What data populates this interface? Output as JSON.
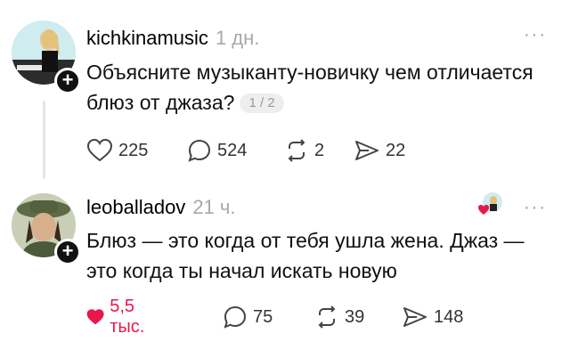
{
  "posts": [
    {
      "username": "kichkinamusic",
      "time": "1 дн.",
      "text": "Объясните музыканту-новичку чем отличается блюз от джаза?",
      "page_indicator": "1 / 2",
      "likes": "225",
      "comments": "524",
      "reposts": "2",
      "shares": "22",
      "liked": false
    },
    {
      "username": "leoballadov",
      "time": "21 ч.",
      "text": "Блюз — это когда от тебя ушла жена. Джаз — это когда ты начал искать новую",
      "likes": "5,5 тыс.",
      "comments": "75",
      "reposts": "39",
      "shares": "148",
      "liked": true
    }
  ],
  "icons": {
    "like": "heart-icon",
    "comment": "comment-bubble-icon",
    "repost": "repost-icon",
    "share": "send-icon",
    "more": "more-options-icon",
    "follow": "plus-icon"
  },
  "colors": {
    "liked": "#e8174a",
    "muted": "#a8a8a8",
    "text": "#111111"
  }
}
